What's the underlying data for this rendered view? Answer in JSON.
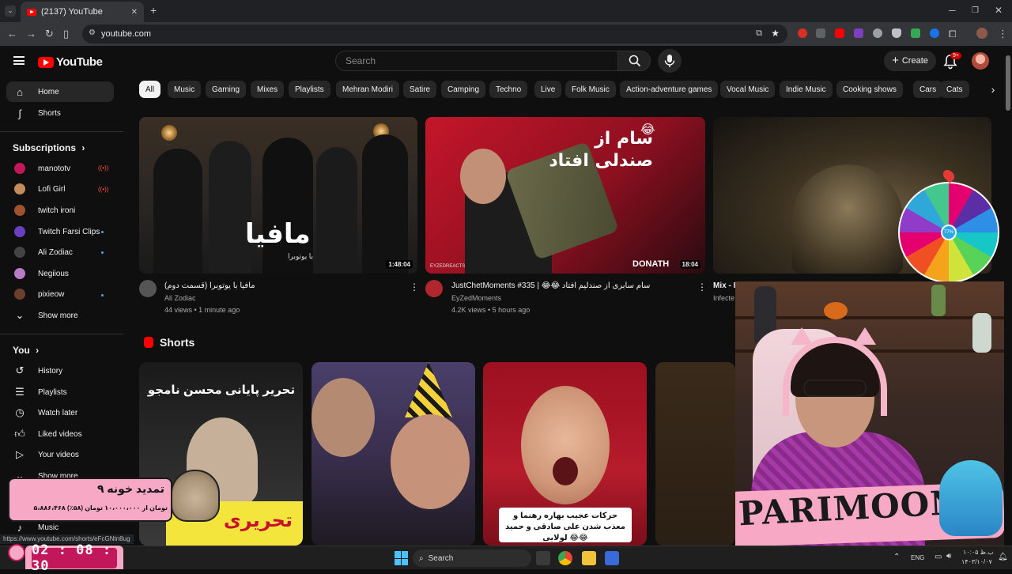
{
  "browser": {
    "tab_title": "(2137) YouTube",
    "url": "youtube.com"
  },
  "header": {
    "logo": "YouTube",
    "search_placeholder": "Search",
    "create_label": "Create",
    "notification_count": "9+"
  },
  "sidebar": {
    "home": "Home",
    "shorts": "Shorts",
    "subscriptions_title": "Subscriptions",
    "subscriptions": [
      {
        "name": "manototv",
        "color": "#c2185b",
        "indicator": "live"
      },
      {
        "name": "Lofi Girl",
        "color": "#c58b5a",
        "indicator": "live"
      },
      {
        "name": "twitch ironi",
        "color": "#a0522d",
        "indicator": ""
      },
      {
        "name": "Twitch Farsi Clips",
        "color": "#6a3fc1",
        "indicator": "dot"
      },
      {
        "name": "Ali Zodiac",
        "color": "#444444",
        "indicator": "dot"
      },
      {
        "name": "Negiious",
        "color": "#b77cc4",
        "indicator": ""
      },
      {
        "name": "pixieow",
        "color": "#6d3f2d",
        "indicator": "dot"
      }
    ],
    "show_more": "Show more",
    "you_title": "You",
    "you_items": [
      "History",
      "Playlists",
      "Watch later",
      "Liked videos",
      "Your videos"
    ],
    "show_more_2": "Show more",
    "music": "Music"
  },
  "chips": [
    "All",
    "Music",
    "Gaming",
    "Mixes",
    "Playlists",
    "Mehran Modiri",
    "Satire",
    "Camping",
    "Techno",
    "Live",
    "Folk Music",
    "Action-adventure games",
    "Vocal Music",
    "Indie Music",
    "Cooking shows",
    "Cars",
    "Cats"
  ],
  "videos": [
    {
      "title": "مافیا با یوتوبرا (قسمت دوم)",
      "channel": "Ali Zodiac",
      "meta": "44 views • 1 minute ago",
      "duration": "1:48:04",
      "thumb_text": "مافیا",
      "thumb_sub": "با یوتوبرا"
    },
    {
      "title": "JustChetMoments #335 | 😂😂 سام سابری از صندلیم افتاد",
      "channel": "EyZedMoments",
      "meta": "4.2K views • 5 hours ago",
      "duration": "18:04",
      "thumb_text": "سام از صندلی افتاد",
      "thumb_brand": "DONATH",
      "thumb_small": "EYZEDREACTS"
    },
    {
      "title": "Mix - I",
      "channel": "Infecte",
      "meta": "",
      "duration": ""
    }
  ],
  "shorts_title": "Shorts",
  "shorts": [
    {
      "top_text": "تحریر پایانی محسن نامجو",
      "bottom_text": "تحریری"
    },
    {
      "top_text": "",
      "bottom_text": ""
    },
    {
      "top_text": "",
      "bottom_text": "حرکات عجیب بهاره رهنما و معذب شدن علی صادقی و حمید لولایی 😂😂"
    }
  ],
  "overlay": {
    "donation_title": "تمدید خونه ۹",
    "donation_amount": "۵،۸۸۶،۴۶۸ تومان از ۱۰،۰۰۰،۰۰۰ تومان (۵۸٪)",
    "streamer_name": "PARIMOON",
    "timer": "02 : 08 : 30",
    "wheel_center": "77%",
    "status_url": "https://www.youtube.com/shorts/eFcGNtn8ug"
  },
  "taskbar": {
    "search": "Search",
    "lang": "ENG",
    "time": "۱۰:۰۵ ب.ظ",
    "date": "۱۴۰۳/۱۰/۰۷"
  }
}
